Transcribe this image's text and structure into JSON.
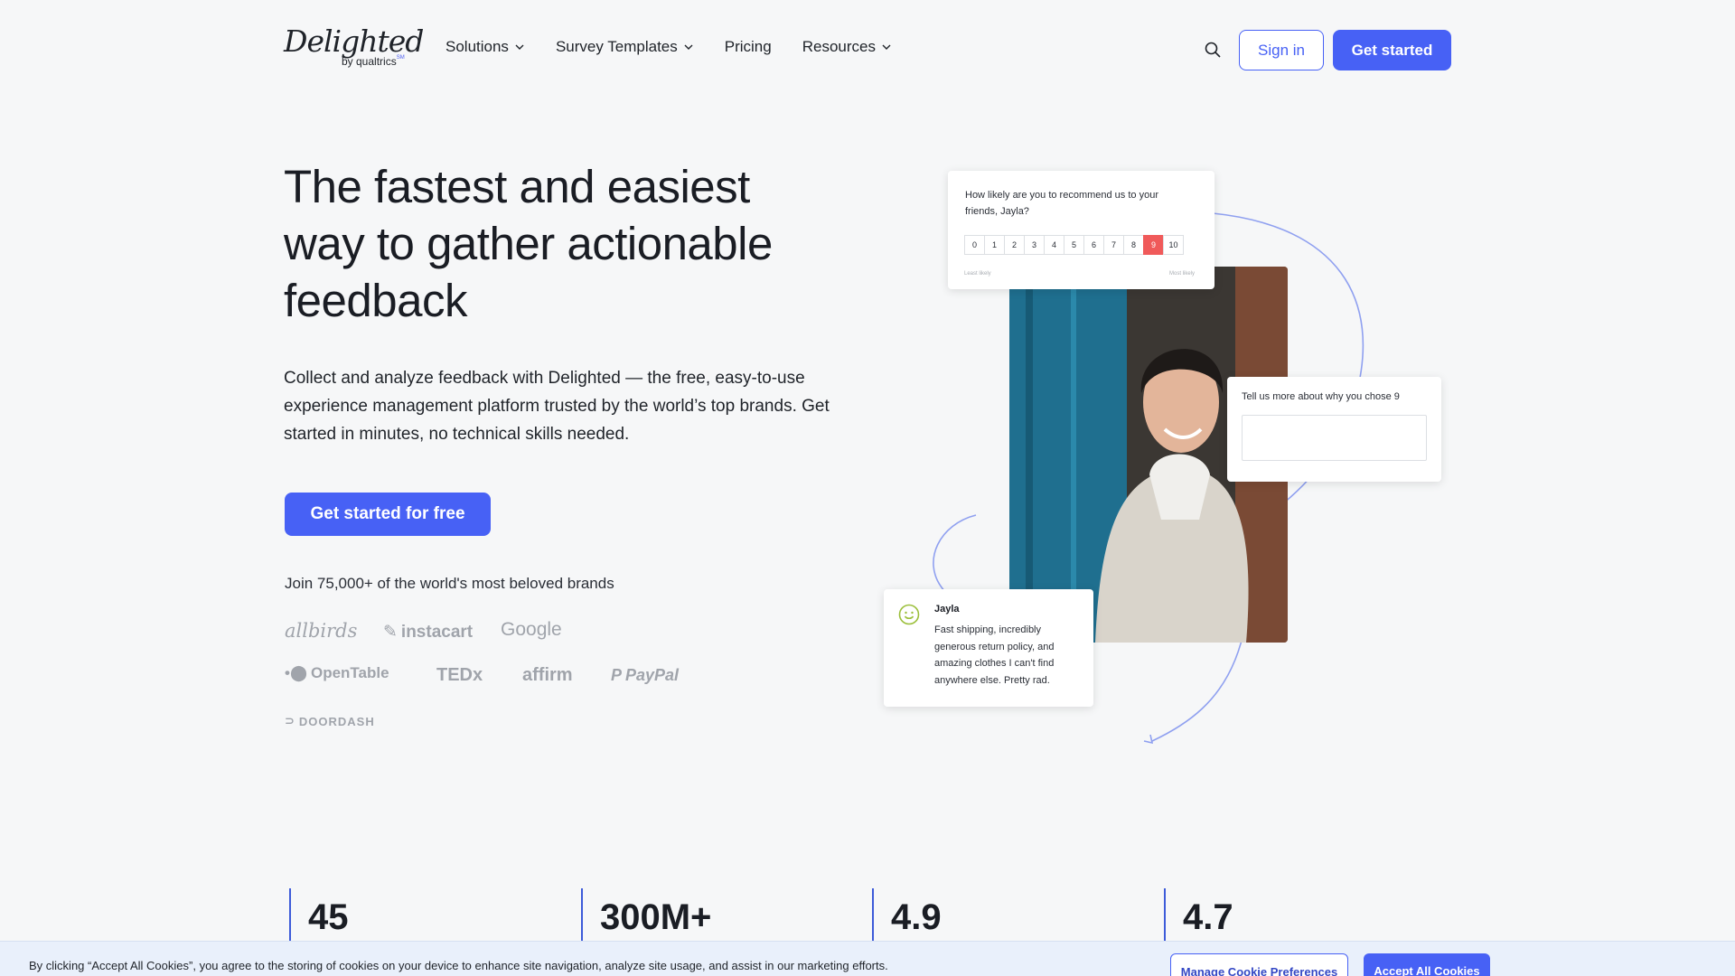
{
  "header": {
    "logo_text": "Delighted",
    "logo_sub": "by qualtrics",
    "logo_sm": "SM",
    "nav": [
      {
        "label": "Solutions",
        "has_dropdown": true
      },
      {
        "label": "Survey Templates",
        "has_dropdown": true
      },
      {
        "label": "Pricing",
        "has_dropdown": false
      },
      {
        "label": "Resources",
        "has_dropdown": true
      }
    ],
    "search_icon": "search-icon",
    "signin_label": "Sign in",
    "getstarted_label": "Get started"
  },
  "hero": {
    "title_lines": [
      "The fastest and easiest",
      "way to gather actionable",
      "feedback"
    ],
    "description": "Collect and analyze feedback with Delighted — the free, easy-to-use experience management platform trusted by the world’s top brands. Get started in minutes, no technical skills needed.",
    "cta_label": "Get started for free",
    "brands_caption": "Join 75,000+ of the world's most beloved brands",
    "brands": [
      "allbirds",
      "instacart",
      "Google",
      "OpenTable",
      "TEDx",
      "affirm",
      "PayPal",
      "DOORDASH"
    ]
  },
  "survey_card": {
    "question": "How likely are you to recommend us to your friends, Jayla?",
    "scale": [
      "0",
      "1",
      "2",
      "3",
      "4",
      "5",
      "6",
      "7",
      "8",
      "9",
      "10"
    ],
    "selected": "9",
    "least_label": "Least likely",
    "most_label": "Most likely"
  },
  "followup_card": {
    "question": "Tell us more about why you chose 9"
  },
  "review_card": {
    "name": "Jayla",
    "text": "Fast shipping, incredibly generous return policy, and amazing clothes I can't find anywhere else. Pretty rad."
  },
  "stats": [
    "45",
    "300M+",
    "4.9",
    "4.7"
  ],
  "cookie": {
    "text": "By clicking “Accept All Cookies”, you agree to the storing of cookies on your device to enhance site navigation, analyze site usage, and assist in our marketing efforts.",
    "manage_label": "Manage Cookie Preferences",
    "accept_label": "Accept All Cookies"
  },
  "colors": {
    "accent": "#4761f5",
    "nps_selected": "#f05a5a",
    "page_bg": "#f6f7f8",
    "brand_gray": "#a0a4ab"
  }
}
